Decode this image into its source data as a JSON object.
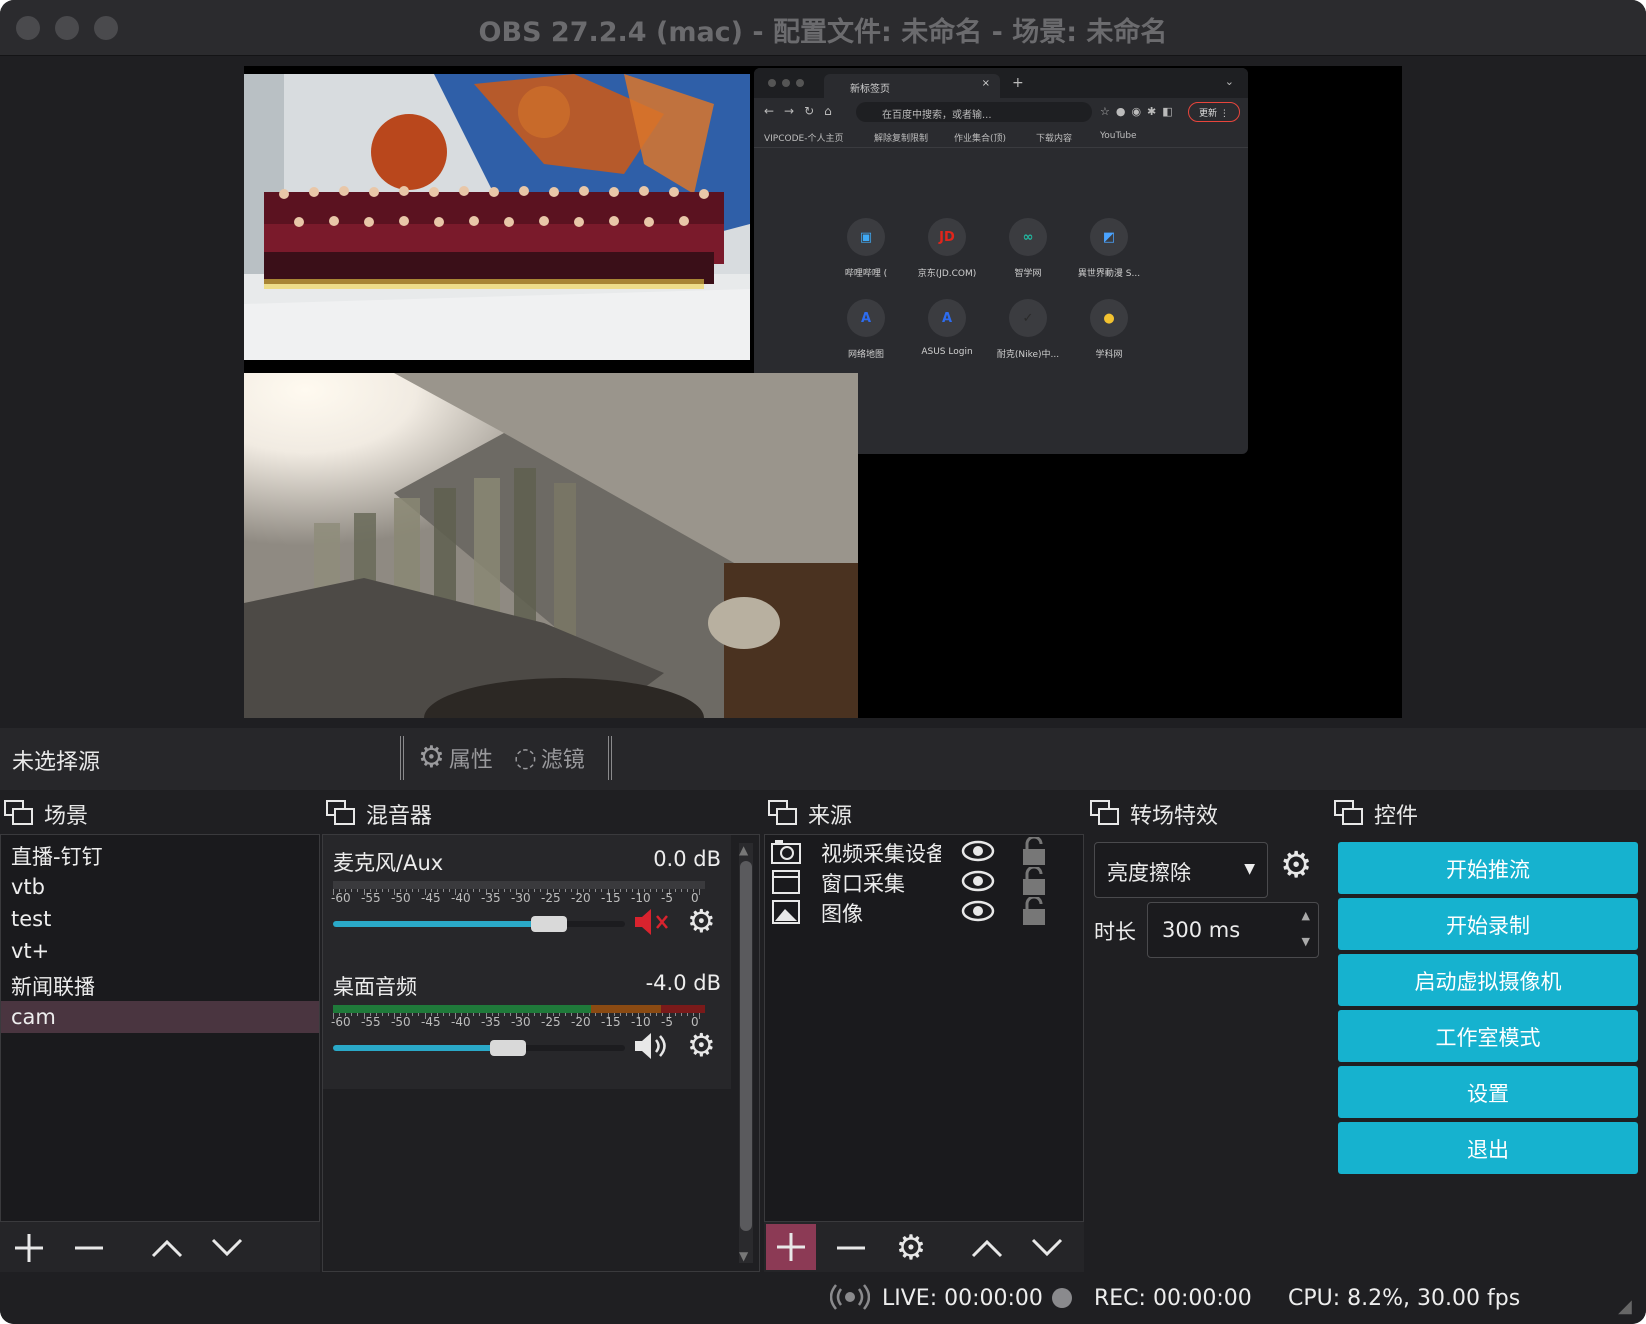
{
  "window": {
    "title": "OBS 27.2.4 (mac) - 配置文件: 未命名 - 场景: 未命名"
  },
  "preview": {
    "browser": {
      "tab_title": "新标签页",
      "omnibox_placeholder": "在百度中搜索，或者输...",
      "update_label": "更新",
      "bookmarks": [
        "VIPCODE-个人主页",
        "解除复制限制",
        "作业集合(顶)",
        "下载内容",
        "YouTube"
      ],
      "shortcuts": [
        {
          "label": "哔哩哔哩 (",
          "glyph": "▣",
          "color": "#3fa9f5"
        },
        {
          "label": "京东(JD.COM)",
          "glyph": "JD",
          "color": "#e1251b"
        },
        {
          "label": "智学网",
          "glyph": "∞",
          "color": "#22b8a0"
        },
        {
          "label": "異世界動漫 S...",
          "glyph": "◩",
          "color": "#4aa3ff"
        },
        {
          "label": "网络地图",
          "glyph": "A",
          "color": "#2d6cf0"
        },
        {
          "label": "ASUS Login",
          "glyph": "A",
          "color": "#2d6cf0"
        },
        {
          "label": "耐克(Nike)中...",
          "glyph": "✓",
          "color": "#2a2a2a"
        },
        {
          "label": "学科网",
          "glyph": "●",
          "color": "#f2c230"
        }
      ]
    }
  },
  "toolbar": {
    "no_source_label": "未选择源",
    "properties_label": "属性",
    "filters_label": "滤镜"
  },
  "scenes": {
    "title": "场景",
    "items": [
      "直播-钉钉",
      "vtb",
      "test",
      "vt+",
      "新闻联播",
      "cam"
    ],
    "selected": "cam"
  },
  "mixer": {
    "title": "混音器",
    "tick_labels": [
      "-60",
      "-55",
      "-50",
      "-45",
      "-40",
      "-35",
      "-30",
      "-25",
      "-20",
      "-15",
      "-10",
      "-5",
      "0"
    ],
    "channels": [
      {
        "name": "麦克风/Aux",
        "db": "0.0 dB",
        "muted": true,
        "volume_fraction": 0.72,
        "level_fraction": 0.0
      },
      {
        "name": "桌面音频",
        "db": "-4.0 dB",
        "muted": false,
        "volume_fraction": 0.58,
        "level_fraction": 1.0
      }
    ]
  },
  "sources": {
    "title": "来源",
    "items": [
      {
        "name": "视频采集设备",
        "icon": "camera-icon"
      },
      {
        "name": "窗口采集",
        "icon": "window-icon"
      },
      {
        "name": "图像",
        "icon": "image-icon"
      }
    ]
  },
  "transitions": {
    "title": "转场特效",
    "selected": "亮度擦除",
    "duration_label": "时长",
    "duration_value": "300 ms"
  },
  "controls": {
    "title": "控件",
    "buttons": [
      "开始推流",
      "开始录制",
      "启动虚拟摄像机",
      "工作室模式",
      "设置",
      "退出"
    ]
  },
  "status": {
    "live": "LIVE: 00:00:00",
    "rec": "REC: 00:00:00",
    "cpu": "CPU: 8.2%, 30.00 fps"
  },
  "colors": {
    "accent": "#16b2cf",
    "selection": "#4a3540",
    "mute_red": "#d9232e",
    "add_button": "#8c3a55"
  }
}
